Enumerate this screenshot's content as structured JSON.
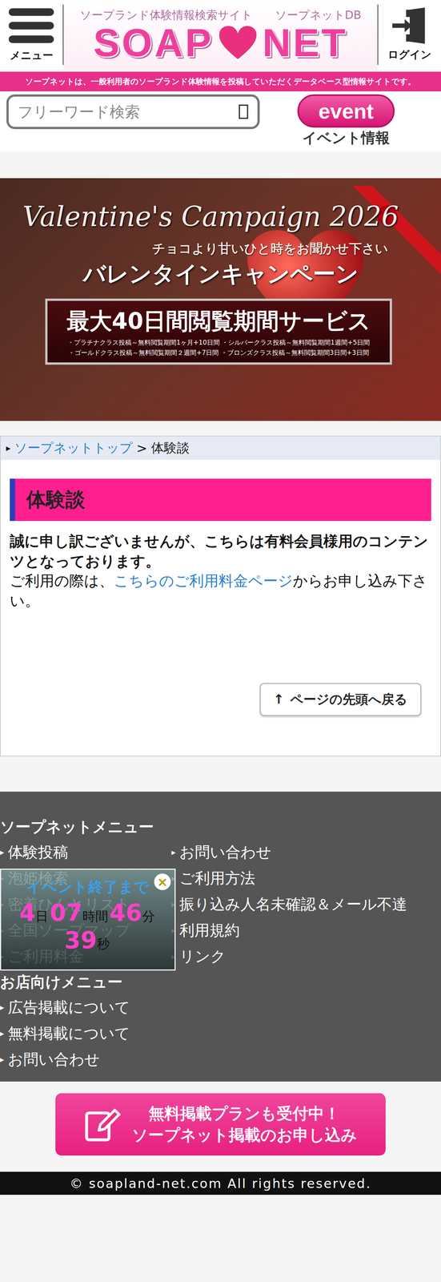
{
  "header": {
    "menu_label": "メニュー",
    "logo": {
      "tagline_left": "ソープランド体験情報検索サイト",
      "tagline_right": "ソープネットDB",
      "word_left": "SOAP",
      "word_right": "NET"
    },
    "login_label": "ログイン"
  },
  "notice": "ソープネットは、一般利用者のソープランド体験情報を投稿していただくデータベース型情報サイトです。",
  "search": {
    "placeholder": "フリーワード検索"
  },
  "event_button": {
    "badge": "event",
    "label": "イベント情報"
  },
  "banner": {
    "script_title": "Valentine's Campaign 2026",
    "subtitle": "チョコより甘いひと時をお聞かせ下さい",
    "title": "バレンタインキャンペーン",
    "offer": "最大40日間閲覧期間サービス",
    "details": [
      "・プラチナクラス投稿～無料閲覧期間1ヶ月+10日間 ・シルバークラス投稿～無料閲覧期間1週間+5日間",
      "・ゴールドクラス投稿～無料閲覧期間２週間+7日間 ・ブロンズクラス投稿～無料閲覧期間3日間+3日間"
    ]
  },
  "breadcrumb": {
    "marker": "▸",
    "separator": ">",
    "items": [
      {
        "label": "ソープネットトップ",
        "link": true
      },
      {
        "label": "体験談",
        "link": false
      }
    ]
  },
  "section": {
    "title": "体験談",
    "message": "誠に申し訳ございませんが、こちらは有料会員様用のコンテンツとなっております。",
    "prefix": "ご利用の際は、",
    "link": "こちらのご利用料金ページ",
    "suffix": "からお申し込み下さい。"
  },
  "back_to_top": {
    "arrow": "↑",
    "label": "ページの先頭へ戻る"
  },
  "footer": {
    "bullet": "▸",
    "menu_title": "ソープネットメニュー",
    "left_items": [
      "体験投稿",
      "泡姫検索",
      "密着ひんとリスト",
      "全国ソープマップ",
      "ご利用料金"
    ],
    "right_items": [
      "お問い合わせ",
      "ご利用方法",
      "振り込み人名未確認＆メール不達",
      "利用規約",
      "リンク"
    ],
    "shop_title": "お店向けメニュー",
    "shop_items": [
      "広告掲載について",
      "無料掲載について",
      "お問い合わせ"
    ]
  },
  "countdown": {
    "title": "イベント終了まで",
    "close": "×",
    "parts": [
      {
        "value": "4",
        "unit": "日"
      },
      {
        "value": "07",
        "unit": "時間"
      },
      {
        "value": "46",
        "unit": "分"
      },
      {
        "value": "39",
        "unit": "秒"
      }
    ]
  },
  "cta": {
    "line1": "無料掲載プランも受付中！",
    "line2": "ソープネット掲載のお申し込み"
  },
  "copyright": "© soapland-net.com All rights reserved."
}
